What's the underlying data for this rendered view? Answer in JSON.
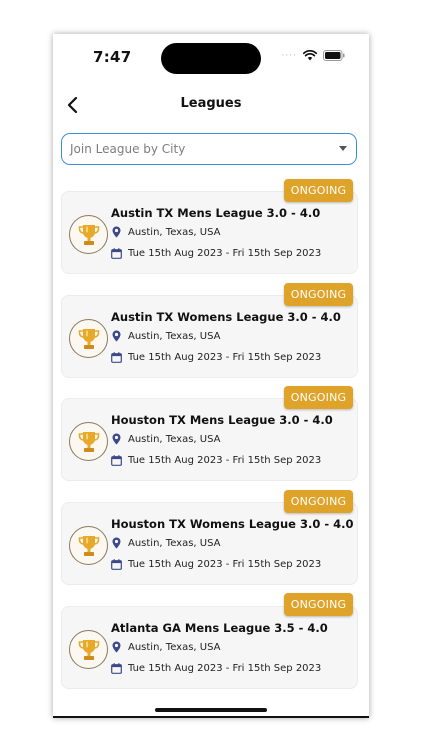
{
  "status_bar": {
    "time": "7:47",
    "signal": "····"
  },
  "header": {
    "title": "Leagues"
  },
  "dropdown": {
    "placeholder": "Join League by City"
  },
  "leagues": [
    {
      "name": "Austin TX Mens League 3.0 - 4.0",
      "status": "ONGOING",
      "location": "Austin, Texas, USA",
      "dates": "Tue 15th Aug 2023 - Fri 15th Sep 2023"
    },
    {
      "name": "Austin TX Womens League 3.0 - 4.0",
      "status": "ONGOING",
      "location": "Austin, Texas, USA",
      "dates": "Tue 15th Aug 2023 - Fri 15th Sep 2023"
    },
    {
      "name": "Houston TX Mens League 3.0 - 4.0",
      "status": "ONGOING",
      "location": "Austin, Texas, USA",
      "dates": "Tue 15th Aug 2023 - Fri 15th Sep 2023"
    },
    {
      "name": "Houston TX Womens League 3.0 - 4.0",
      "status": "ONGOING",
      "location": "Austin, Texas, USA",
      "dates": "Tue 15th Aug 2023 - Fri 15th Sep 2023"
    },
    {
      "name": "Atlanta GA Mens League 3.5 - 4.0",
      "status": "ONGOING",
      "location": "Austin, Texas, USA",
      "dates": "Tue 15th Aug 2023 - Fri 15th Sep 2023"
    }
  ],
  "colors": {
    "accent_border": "#3d8fd6",
    "badge": "#e0a32a",
    "icon": "#3c4a8a",
    "trophy": "#e8a92b"
  },
  "icons": {
    "back": "chevron-left-icon",
    "dropdown": "caret-down-icon",
    "location": "map-pin-icon",
    "date": "calendar-icon",
    "avatar": "trophy-icon"
  }
}
